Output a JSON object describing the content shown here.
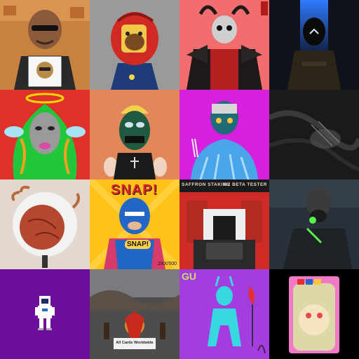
{
  "grid": {
    "tiles": [
      {
        "id": "t1",
        "bg": "#c8823f",
        "accent": "#3a2a1d",
        "overlay": ""
      },
      {
        "id": "t2",
        "bg": "#9a9a9a",
        "accent": "#d12a25",
        "overlay": ""
      },
      {
        "id": "t3",
        "bg": "#f26d6d",
        "accent": "#1f1a1a",
        "overlay": ""
      },
      {
        "id": "t4",
        "bg": "#11131c",
        "accent": "#2f7bff",
        "overlay": ""
      },
      {
        "id": "t5",
        "bg": "#e0302a",
        "accent": "#22c63a",
        "overlay": ""
      },
      {
        "id": "t6",
        "bg": "#e1875b",
        "accent": "#1f5a40",
        "overlay": ""
      },
      {
        "id": "t7",
        "bg": "#d81fe0",
        "accent": "#2f6cbb",
        "overlay": ""
      },
      {
        "id": "t8",
        "bg": "#1a1a1a",
        "accent": "#555555",
        "overlay": ""
      },
      {
        "id": "t9",
        "bg": "#e3d8cf",
        "accent": "#b44830",
        "overlay": ""
      },
      {
        "id": "t10",
        "bg": "#ffc21a",
        "accent": "#2266c8",
        "overlay": "SNAP!"
      },
      {
        "id": "t11",
        "bg": "#cf2b26",
        "accent": "#1b1b1b",
        "overlay": ""
      },
      {
        "id": "t12",
        "bg": "#28313a",
        "accent": "#5df24b",
        "overlay": ""
      },
      {
        "id": "t13",
        "bg": "#6e0f9b",
        "accent": "#ffffff",
        "overlay": ""
      },
      {
        "id": "t14",
        "bg": "#4d4d4d",
        "accent": "#c8291d",
        "overlay": ""
      },
      {
        "id": "t15",
        "bg": "#a53ce0",
        "accent": "#38d8e0",
        "overlay": ""
      },
      {
        "id": "t16",
        "bg": "#000000",
        "accent": "#d7f0a0",
        "overlay": ""
      }
    ]
  },
  "labels": {
    "t10_bubble": "SNAP!",
    "t10_chest": "SNAP!",
    "t10_counter": "2XX/500",
    "t11_left": "SAFFRON STAKING",
    "t11_right": "OZ BETA TESTER",
    "t14_caption": "All Cards Worldwide",
    "t15_tag": "GU"
  }
}
